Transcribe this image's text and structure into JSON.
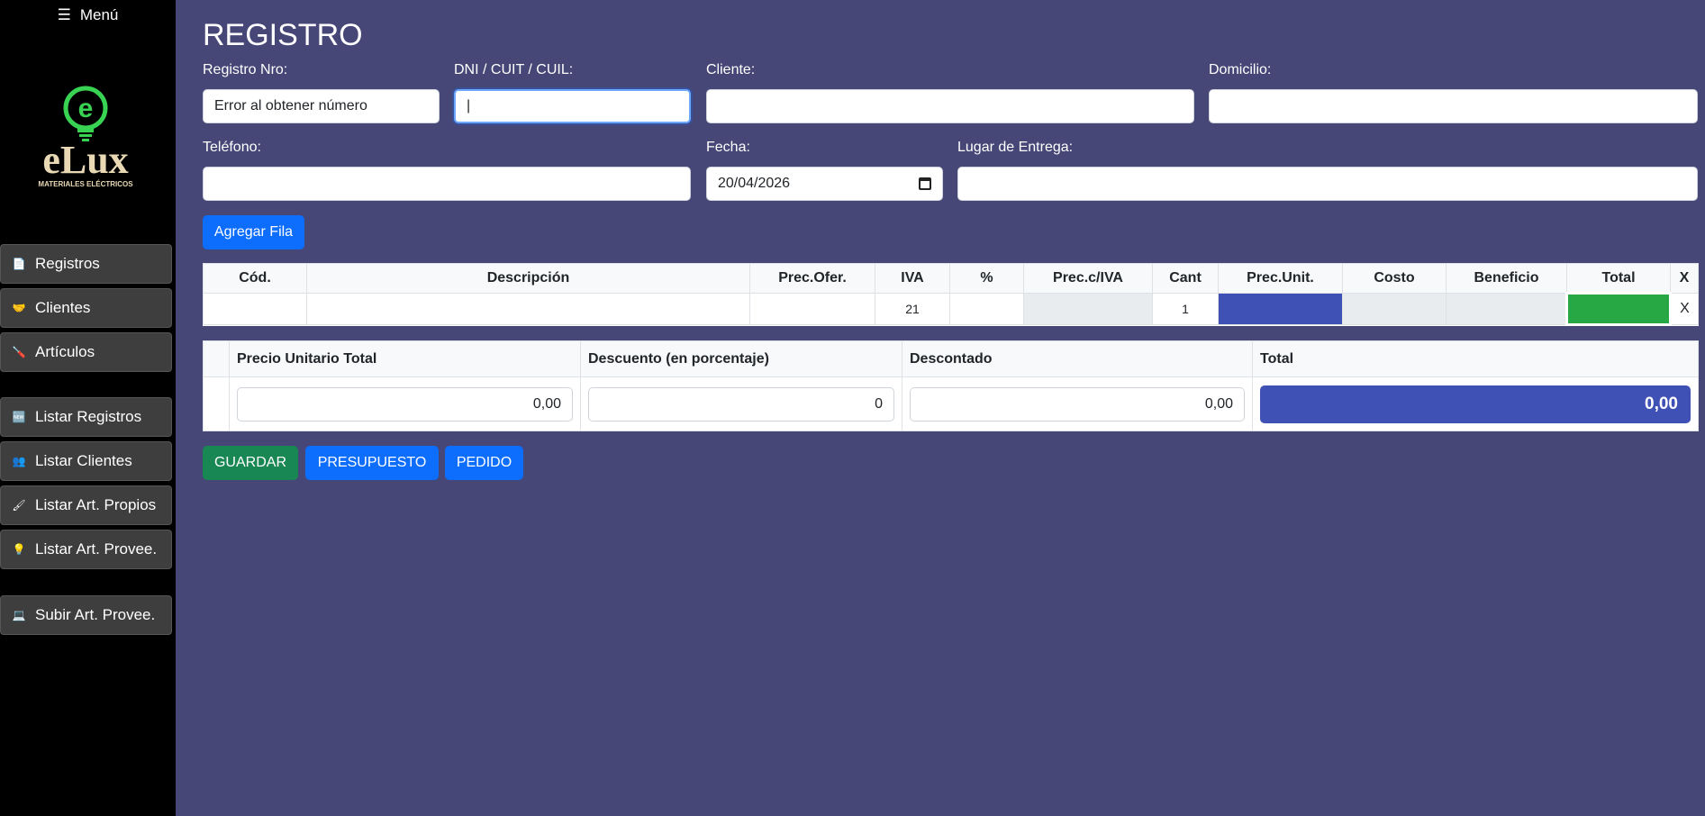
{
  "sidebar": {
    "menu_icon": "☰",
    "menu_label": "Menú",
    "logo": {
      "brand": "eLux",
      "tagline": "MATERIALES ELÉCTRICOS",
      "icon": "lightbulb-e-icon"
    },
    "items": [
      {
        "icon": "document-icon",
        "glyph": "📄",
        "label": "Registros"
      },
      {
        "icon": "handshake-icon",
        "glyph": "🤝",
        "label": "Clientes"
      },
      {
        "icon": "screwdriver-icon",
        "glyph": "🪛",
        "label": "Artículos"
      },
      {
        "icon": "new-icon",
        "glyph": "🆕",
        "label": "Listar Registros"
      },
      {
        "icon": "people-icon",
        "glyph": "👥",
        "label": "Listar Clientes"
      },
      {
        "icon": "brush-icon",
        "glyph": "🖌",
        "label": "Listar Art. Propios"
      },
      {
        "icon": "lightbulb-icon",
        "glyph": "💡",
        "label": "Listar Art. Provee."
      },
      {
        "icon": "laptop-icon",
        "glyph": "💻",
        "label": "Subir Art. Provee."
      }
    ]
  },
  "form": {
    "title": "REGISTRO",
    "registro_label": "Registro Nro:",
    "registro_value": "Error al obtener número",
    "dni_label": "DNI / CUIT / CUIL:",
    "dni_value": "|",
    "cliente_label": "Cliente:",
    "cliente_value": "",
    "domicilio_label": "Domicilio:",
    "domicilio_value": "",
    "telefono_label": "Teléfono:",
    "telefono_value": "",
    "fecha_label": "Fecha:",
    "fecha_value": "20/04/2026",
    "lugar_label": "Lugar de Entrega:",
    "lugar_value": "",
    "add_row_label": "Agregar Fila"
  },
  "items_table": {
    "headers": [
      "Cód.",
      "Descripción",
      "Prec.Ofer.",
      "IVA",
      "%",
      "Prec.c/IVA",
      "Cant",
      "Prec.Unit.",
      "Costo",
      "Beneficio",
      "Total",
      "X"
    ],
    "rows": [
      {
        "cod": "",
        "descripcion": "",
        "prec_ofer": "",
        "iva": "21",
        "pct": "",
        "prec_civa": "",
        "cant": "1",
        "prec_unit": "",
        "costo": "",
        "beneficio": "",
        "total": "",
        "remove": "X"
      }
    ]
  },
  "summary": {
    "headers": [
      "Precio Unitario Total",
      "Descuento (en porcentaje)",
      "Descontado",
      "Total"
    ],
    "precio_unitario_total": "0,00",
    "descuento": "0",
    "descontado": "0,00",
    "total": "0,00"
  },
  "actions": {
    "guardar": "GUARDAR",
    "presupuesto": "PRESUPUESTO",
    "pedido": "PEDIDO"
  },
  "colors": {
    "background": "#464677",
    "sidebar": "#000000",
    "primary": "#0d6efd",
    "success": "#198754",
    "indigo": "#3f51b5"
  }
}
